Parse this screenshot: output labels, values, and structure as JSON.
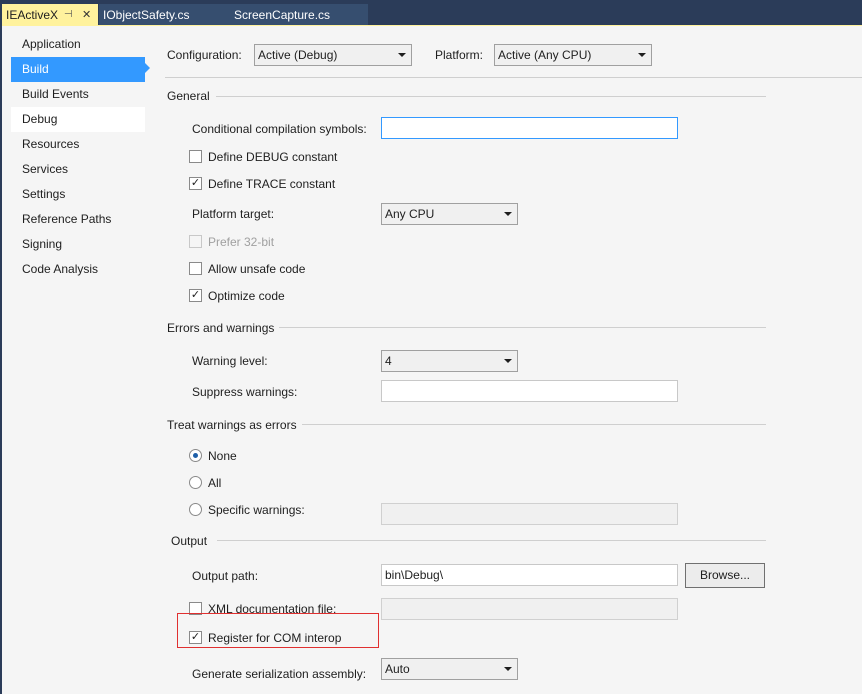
{
  "tabs": {
    "active": "IEActiveX",
    "pin_glyph": "⊣",
    "close_glyph": "✕",
    "others": [
      "IObjectSafety.cs",
      "ScreenCapture.cs"
    ]
  },
  "sidebar": {
    "items": [
      "Application",
      "Build",
      "Build Events",
      "Debug",
      "Resources",
      "Services",
      "Settings",
      "Reference Paths",
      "Signing",
      "Code Analysis"
    ],
    "selected": "Build"
  },
  "config": {
    "configuration_label": "Configuration:",
    "configuration_value": "Active (Debug)",
    "platform_label": "Platform:",
    "platform_value": "Active (Any CPU)"
  },
  "general": {
    "title": "General",
    "symbols_label": "Conditional compilation symbols:",
    "symbols_value": "",
    "define_debug": "Define DEBUG constant",
    "define_trace": "Define TRACE constant",
    "platform_target_label": "Platform target:",
    "platform_target_value": "Any CPU",
    "prefer32": "Prefer 32-bit",
    "unsafe": "Allow unsafe code",
    "optimize": "Optimize code"
  },
  "errors": {
    "title": "Errors and warnings",
    "warning_level_label": "Warning level:",
    "warning_level_value": "4",
    "suppress_label": "Suppress warnings:",
    "suppress_value": ""
  },
  "treat": {
    "title": "Treat warnings as errors",
    "none": "None",
    "all": "All",
    "specific": "Specific warnings:",
    "specific_value": ""
  },
  "output": {
    "title": "Output",
    "path_label": "Output path:",
    "path_value": "bin\\Debug\\",
    "browse": "Browse...",
    "xml_label": "XML documentation file:",
    "xml_value": "",
    "com_label": "Register for COM interop",
    "serial_label": "Generate serialization assembly:",
    "serial_value": "Auto"
  },
  "check_glyph": "✓",
  "colors": {
    "active_tab": "#fff29d",
    "tab_strip": "#2b3c59",
    "selected_item": "#3399ff",
    "annotation_box": "#e03030"
  }
}
